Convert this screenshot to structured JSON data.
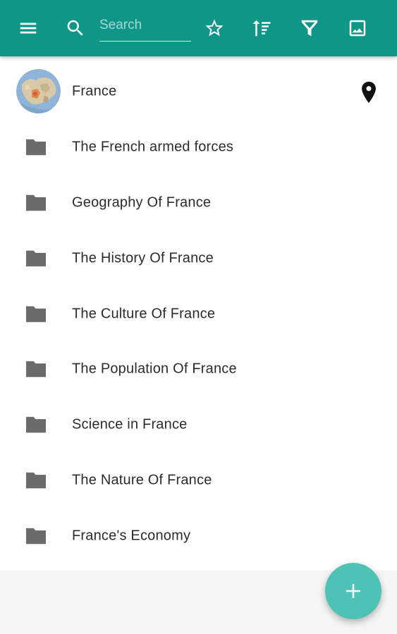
{
  "toolbar": {
    "menu_icon": "menu-icon",
    "search_icon": "search-icon",
    "search_placeholder": "Search",
    "search_value": "",
    "actions": [
      "star-icon",
      "sort-icon",
      "filter-icon",
      "image-icon"
    ],
    "color": "#0f9686"
  },
  "header_item": {
    "label": "France",
    "avatar": "europe-map-thumbnail",
    "trailing_icon": "location-pin-icon"
  },
  "folders": [
    {
      "label": "The French armed forces",
      "icon": "folder-icon"
    },
    {
      "label": "Geography Of France",
      "icon": "folder-icon"
    },
    {
      "label": "The History Of France",
      "icon": "folder-icon"
    },
    {
      "label": "The Culture Of France",
      "icon": "folder-icon"
    },
    {
      "label": "The Population Of France",
      "icon": "folder-icon"
    },
    {
      "label": "Science in France",
      "icon": "folder-icon"
    },
    {
      "label": "The Nature Of France",
      "icon": "folder-icon"
    },
    {
      "label": "France's Economy",
      "icon": "folder-icon"
    }
  ],
  "fab": {
    "icon": "add-icon",
    "color": "#4ec3b5"
  }
}
